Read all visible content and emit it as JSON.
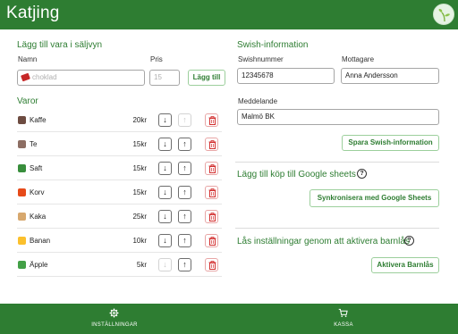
{
  "header": {
    "title": "Katjing"
  },
  "add_item": {
    "title": "Lägg till vara i säljvyn",
    "name_label": "Namn",
    "name_placeholder": "choklad",
    "price_label": "Pris",
    "price_placeholder": "15",
    "add_button": "Lägg till"
  },
  "items": {
    "title": "Varor",
    "list": [
      {
        "name": "Kaffe",
        "price": "20kr",
        "icon": "coffee-icon",
        "color": "#6d4c41",
        "up_disabled": true,
        "down_disabled": false
      },
      {
        "name": "Te",
        "price": "15kr",
        "icon": "tea-icon",
        "color": "#8d6e63",
        "up_disabled": false,
        "down_disabled": false
      },
      {
        "name": "Saft",
        "price": "15kr",
        "icon": "juice-icon",
        "color": "#388e3c",
        "up_disabled": false,
        "down_disabled": false
      },
      {
        "name": "Korv",
        "price": "15kr",
        "icon": "hotdog-icon",
        "color": "#e64a19",
        "up_disabled": false,
        "down_disabled": false
      },
      {
        "name": "Kaka",
        "price": "25kr",
        "icon": "cake-icon",
        "color": "#d7a86e",
        "up_disabled": false,
        "down_disabled": false
      },
      {
        "name": "Banan",
        "price": "10kr",
        "icon": "banana-icon",
        "color": "#fbc02d",
        "up_disabled": false,
        "down_disabled": false
      },
      {
        "name": "Äpple",
        "price": "5kr",
        "icon": "apple-icon",
        "color": "#43a047",
        "up_disabled": false,
        "down_disabled": true
      }
    ]
  },
  "swish": {
    "title": "Swish-information",
    "number_label": "Swishnummer",
    "number_value": "12345678",
    "recipient_label": "Mottagare",
    "recipient_value": "Anna Andersson",
    "message_label": "Meddelande",
    "message_value": "Malmö BK",
    "save_button": "Spara Swish-information"
  },
  "sheets": {
    "title": "Lägg till köp till Google sheets",
    "sync_button": "Synkronisera med Google Sheets"
  },
  "lock": {
    "title": "Lås inställningar genom att aktivera barnlås",
    "activate_button": "Aktivera Barnlås"
  },
  "tabs": {
    "settings": "INSTÄLLNINGAR",
    "checkout": "KASSA"
  },
  "colors": {
    "primary": "#2e7d32",
    "danger": "#c62828"
  }
}
